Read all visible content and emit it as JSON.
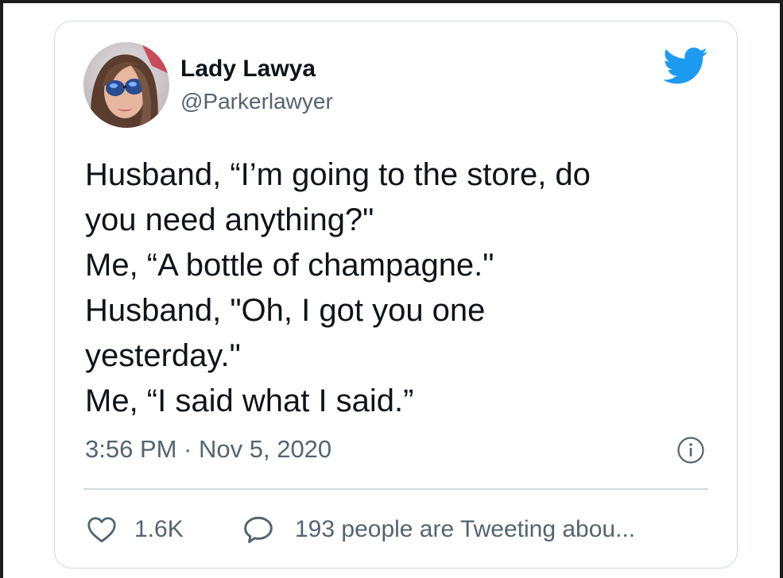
{
  "author": {
    "name": "Lady Lawya",
    "handle": "@Parkerlawyer"
  },
  "tweet": {
    "lines": [
      "Husband, “I’m going to the store, do",
      "you need anything?\"",
      "Me, “A bottle of champagne.\"",
      "Husband, \"Oh, I got you one",
      "yesterday.\"",
      "Me, “I said what I said.”"
    ],
    "timestamp": "3:56 PM · Nov 5, 2020"
  },
  "actions": {
    "likes": "1.6K",
    "replies": "193 people are Tweeting abou..."
  },
  "icons": {
    "brand": "twitter-bird-icon",
    "info": "info-icon",
    "like": "heart-icon",
    "reply": "speech-bubble-icon"
  },
  "colors": {
    "brand": "#1d9bf0",
    "text": "#0f1419",
    "secondary": "#536471",
    "border": "#cfd9de"
  }
}
